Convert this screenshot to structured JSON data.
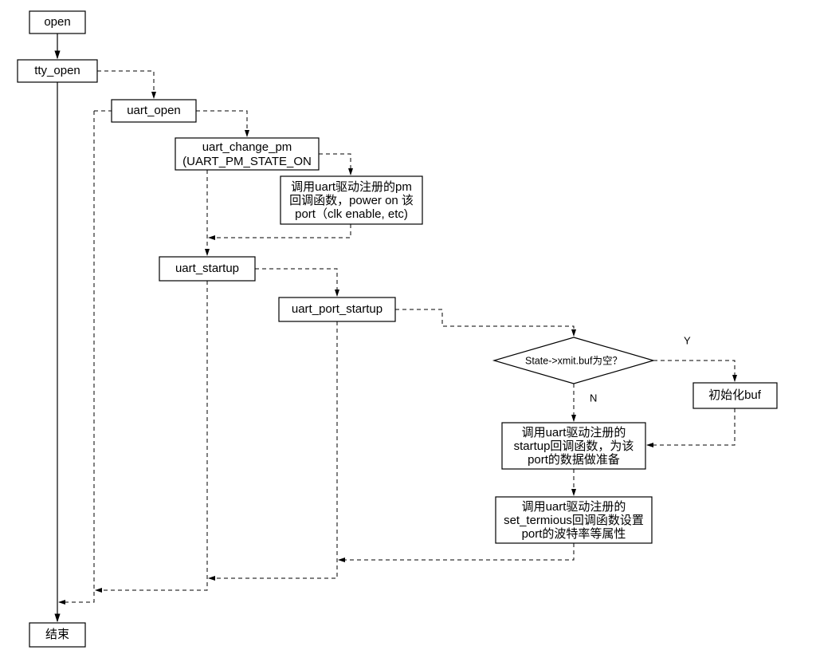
{
  "nodes": {
    "open": "open",
    "tty_open": "tty_open",
    "uart_open": "uart_open",
    "uart_change_pm_l1": "uart_change_pm",
    "uart_change_pm_l2": "(UART_PM_STATE_ON",
    "pm_cb_l1": "调用uart驱动注册的pm",
    "pm_cb_l2": "回调函数，power on 该",
    "pm_cb_l3": "port（clk enable, etc)",
    "uart_startup": "uart_startup",
    "uart_port_startup": "uart_port_startup",
    "decision": "State->xmit.buf为空？",
    "init_buf": "初始化buf",
    "startup_cb_l1": "调用uart驱动注册的",
    "startup_cb_l2": "startup回调函数，为该",
    "startup_cb_l3": "port的数据做准备",
    "termios_cb_l1": "调用uart驱动注册的",
    "termios_cb_l2": "set_termious回调函数设置",
    "termios_cb_l3": "port的波特率等属性",
    "end": "结束"
  },
  "labels": {
    "yes": "Y",
    "no": "N"
  }
}
